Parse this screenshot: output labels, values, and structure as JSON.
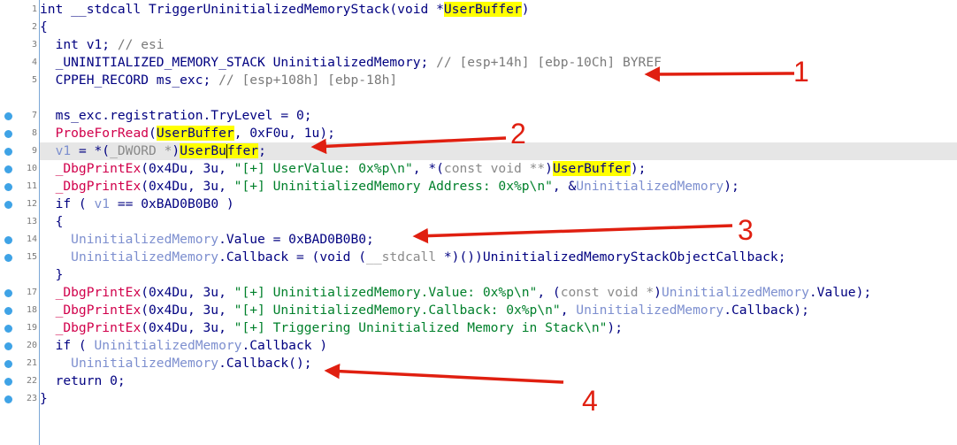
{
  "editor": {
    "lines": [
      {
        "n": "1",
        "bp": false,
        "hl": false,
        "parts": [
          [
            "n",
            "int __stdcall TriggerUninitializedMemoryStack(void *"
          ],
          [
            "y",
            "UserBuffer"
          ],
          [
            "n",
            ")"
          ]
        ]
      },
      {
        "n": "2",
        "bp": false,
        "hl": false,
        "parts": [
          [
            "n",
            "{"
          ]
        ]
      },
      {
        "n": "3",
        "bp": false,
        "hl": false,
        "parts": [
          [
            "n",
            "  int v1; "
          ],
          [
            "c",
            "// esi"
          ]
        ]
      },
      {
        "n": "4",
        "bp": false,
        "hl": false,
        "parts": [
          [
            "n",
            "  _UNINITIALIZED_MEMORY_STACK UninitializedMemory; "
          ],
          [
            "c",
            "// [esp+14h] [ebp-10Ch] BYREF"
          ]
        ]
      },
      {
        "n": "5",
        "bp": false,
        "hl": false,
        "parts": [
          [
            "n",
            "  CPPEH_RECORD ms_exc; "
          ],
          [
            "c",
            "// [esp+108h] [ebp-18h]"
          ]
        ]
      },
      {
        "n": "",
        "bp": false,
        "hl": false,
        "parts": []
      },
      {
        "n": "7",
        "bp": true,
        "hl": false,
        "parts": [
          [
            "n",
            "  ms_exc.registration.TryLevel = 0;"
          ]
        ]
      },
      {
        "n": "8",
        "bp": true,
        "hl": false,
        "parts": [
          [
            "n",
            "  "
          ],
          [
            "f",
            "ProbeForRead"
          ],
          [
            "n",
            "("
          ],
          [
            "y",
            "UserBuffer"
          ],
          [
            "n",
            ", 0xF0u, 1u);"
          ]
        ]
      },
      {
        "n": "9",
        "bp": true,
        "hl": true,
        "parts": [
          [
            "n",
            "  "
          ],
          [
            "l",
            "v1"
          ],
          [
            "n",
            " = *("
          ],
          [
            "g",
            "_DWORD *"
          ],
          [
            "n",
            ")"
          ],
          [
            "y",
            "UserBu"
          ],
          [
            "caret",
            ""
          ],
          [
            "y",
            "ffer"
          ],
          [
            "n",
            ";"
          ]
        ]
      },
      {
        "n": "10",
        "bp": true,
        "hl": false,
        "parts": [
          [
            "n",
            "  "
          ],
          [
            "f",
            "_DbgPrintEx"
          ],
          [
            "n",
            "(0x4Du, 3u, "
          ],
          [
            "s",
            "\"[+] UserValue: 0x%p\\n\""
          ],
          [
            "n",
            ", *("
          ],
          [
            "g",
            "const void **"
          ],
          [
            "n",
            ")"
          ],
          [
            "y",
            "UserBuffer"
          ],
          [
            "n",
            ");"
          ]
        ]
      },
      {
        "n": "11",
        "bp": true,
        "hl": false,
        "parts": [
          [
            "n",
            "  "
          ],
          [
            "f",
            "_DbgPrintEx"
          ],
          [
            "n",
            "(0x4Du, 3u, "
          ],
          [
            "s",
            "\"[+] UninitializedMemory Address: 0x%p\\n\""
          ],
          [
            "n",
            ", &"
          ],
          [
            "l",
            "UninitializedMemory"
          ],
          [
            "n",
            ");"
          ]
        ]
      },
      {
        "n": "12",
        "bp": true,
        "hl": false,
        "parts": [
          [
            "n",
            "  if ( "
          ],
          [
            "l",
            "v1"
          ],
          [
            "n",
            " == 0xBAD0B0B0 )"
          ]
        ]
      },
      {
        "n": "13",
        "bp": false,
        "hl": false,
        "parts": [
          [
            "n",
            "  {"
          ]
        ]
      },
      {
        "n": "14",
        "bp": true,
        "hl": false,
        "parts": [
          [
            "n",
            "    "
          ],
          [
            "l",
            "UninitializedMemory"
          ],
          [
            "n",
            ".Value = 0xBAD0B0B0;"
          ]
        ]
      },
      {
        "n": "15",
        "bp": true,
        "hl": false,
        "parts": [
          [
            "n",
            "    "
          ],
          [
            "l",
            "UninitializedMemory"
          ],
          [
            "n",
            ".Callback = (void ("
          ],
          [
            "g",
            "__stdcall"
          ],
          [
            "n",
            " *)())UninitializedMemoryStackObjectCallback;"
          ]
        ]
      },
      {
        "n": "",
        "bp": false,
        "hl": false,
        "parts": [
          [
            "n",
            "  }"
          ]
        ]
      },
      {
        "n": "17",
        "bp": true,
        "hl": false,
        "parts": [
          [
            "n",
            "  "
          ],
          [
            "f",
            "_DbgPrintEx"
          ],
          [
            "n",
            "(0x4Du, 3u, "
          ],
          [
            "s",
            "\"[+] UninitializedMemory.Value: 0x%p\\n\""
          ],
          [
            "n",
            ", ("
          ],
          [
            "g",
            "const void *"
          ],
          [
            "n",
            ")"
          ],
          [
            "l",
            "UninitializedMemory"
          ],
          [
            "n",
            ".Value);"
          ]
        ]
      },
      {
        "n": "18",
        "bp": true,
        "hl": false,
        "parts": [
          [
            "n",
            "  "
          ],
          [
            "f",
            "_DbgPrintEx"
          ],
          [
            "n",
            "(0x4Du, 3u, "
          ],
          [
            "s",
            "\"[+] UninitializedMemory.Callback: 0x%p\\n\""
          ],
          [
            "n",
            ", "
          ],
          [
            "l",
            "UninitializedMemory"
          ],
          [
            "n",
            ".Callback);"
          ]
        ]
      },
      {
        "n": "19",
        "bp": true,
        "hl": false,
        "parts": [
          [
            "n",
            "  "
          ],
          [
            "f",
            "_DbgPrintEx"
          ],
          [
            "n",
            "(0x4Du, 3u, "
          ],
          [
            "s",
            "\"[+] Triggering Uninitialized Memory in Stack\\n\""
          ],
          [
            "n",
            ");"
          ]
        ]
      },
      {
        "n": "20",
        "bp": true,
        "hl": false,
        "parts": [
          [
            "n",
            "  if ( "
          ],
          [
            "l",
            "UninitializedMemory"
          ],
          [
            "n",
            ".Callback )"
          ]
        ]
      },
      {
        "n": "21",
        "bp": true,
        "hl": false,
        "parts": [
          [
            "n",
            "    "
          ],
          [
            "l",
            "UninitializedMemory"
          ],
          [
            "n",
            ".Callback();"
          ]
        ]
      },
      {
        "n": "22",
        "bp": true,
        "hl": false,
        "parts": [
          [
            "n",
            "  return 0;"
          ]
        ]
      },
      {
        "n": "23",
        "bp": true,
        "hl": false,
        "parts": [
          [
            "n",
            "}"
          ]
        ]
      }
    ]
  },
  "annotations": {
    "labels": [
      "1",
      "2",
      "3",
      "4"
    ],
    "color": "#e01f10"
  },
  "colors": {
    "code": "#000080",
    "comment": "#7a7a7a",
    "function": "#d1004b",
    "string": "#00802b",
    "type": "#8a8a8a",
    "local": "#7d8fcf",
    "search_highlight": "#ffff00",
    "current_line": "#e6e6e6",
    "breakpoint_dot": "#3fa3e6"
  },
  "icons": {
    "breakpoint_marker": "breakpoint-dot-icon",
    "annotation_arrow": "red-arrow-icon"
  }
}
